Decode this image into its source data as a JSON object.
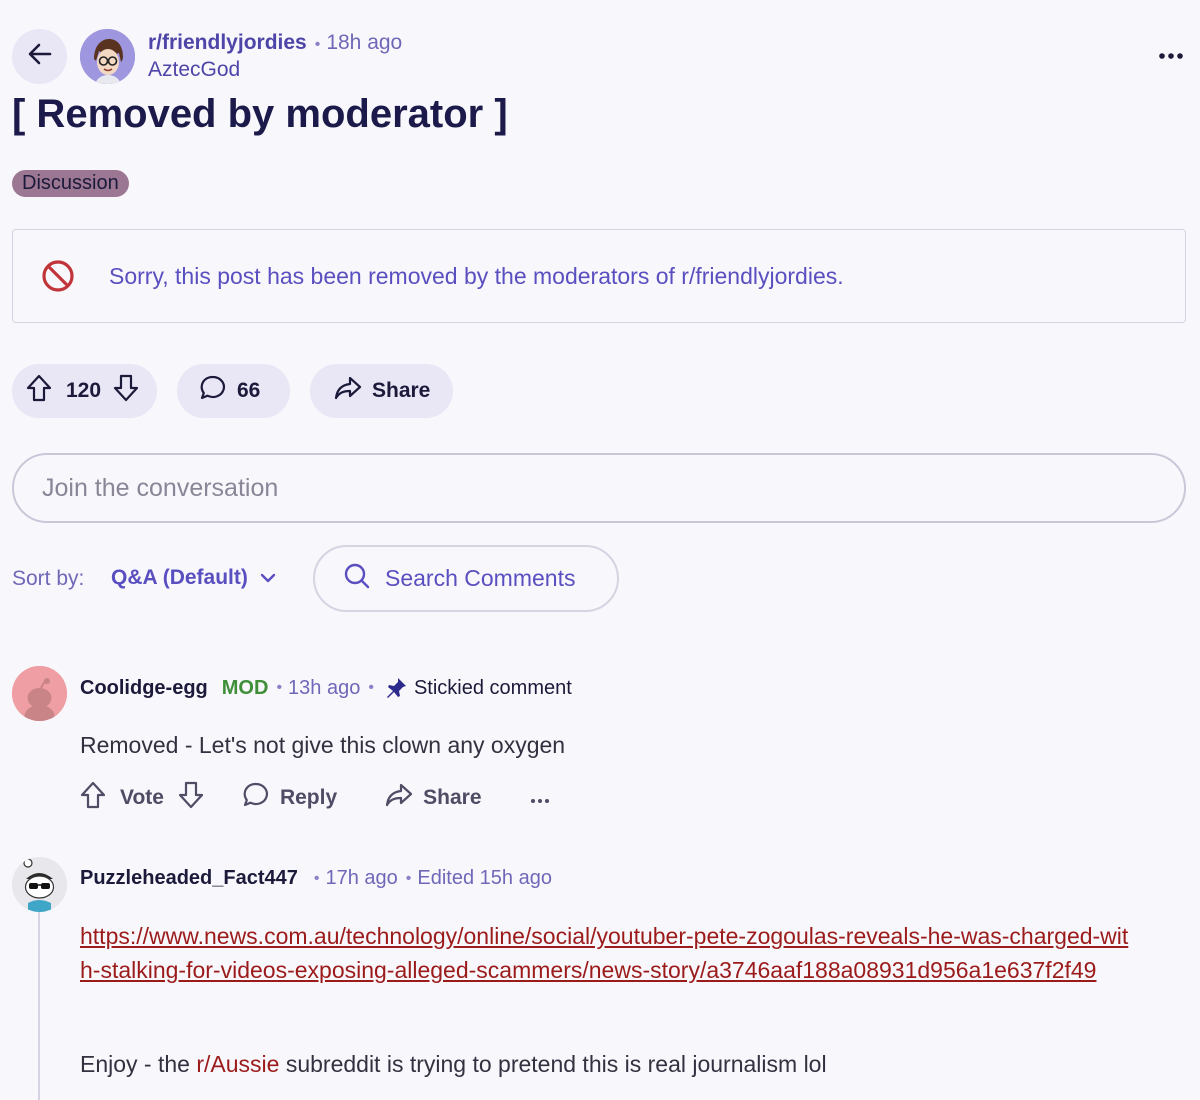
{
  "header": {
    "subreddit": "r/friendlyjordies",
    "post_age": "18h ago",
    "author": "AztecGod"
  },
  "post": {
    "title": "[ Removed by moderator ]",
    "flair": "Discussion",
    "removed_notice": "Sorry, this post has been removed by the moderators of r/friendlyjordies.",
    "votes": "120",
    "comments": "66",
    "share_label": "Share"
  },
  "composer": {
    "placeholder": "Join the conversation"
  },
  "sort": {
    "label": "Sort by:",
    "value": "Q&A (Default)",
    "search_label": "Search Comments"
  },
  "comments": [
    {
      "author": "Coolidge-egg",
      "badge": "MOD",
      "age": "13h ago",
      "sticky_label": "Stickied comment",
      "body": "Removed - Let's not give this clown any oxygen",
      "actions": {
        "vote": "Vote",
        "reply": "Reply",
        "share": "Share"
      }
    },
    {
      "author": "Puzzleheaded_Fact447",
      "age": "17h ago",
      "edited": "Edited 15h ago",
      "link": "https://www.news.com.au/technology/online/social/youtuber-pete-zogoulas-reveals-he-was-charged-with-stalking-for-videos-exposing-alleged-scammers/news-story/a3746aaf188a08931d956a1e637f2f49",
      "body_before": "Enjoy - the ",
      "body_link": "r/Aussie",
      "body_after": " subreddit is trying to pretend this is real journalism lol"
    }
  ],
  "colors": {
    "accent": "#5a4fc0",
    "pill_bg": "#e9e6f6",
    "mod_green": "#3f8f3a",
    "link_red": "#9b1b1b",
    "flair_bg": "#9c7793"
  },
  "icons": [
    "back-arrow-icon",
    "more-icon",
    "ban-icon",
    "upvote-icon",
    "downvote-icon",
    "comment-icon",
    "share-icon",
    "chevron-down-icon",
    "search-icon",
    "pin-icon",
    "ellipsis-icon"
  ]
}
